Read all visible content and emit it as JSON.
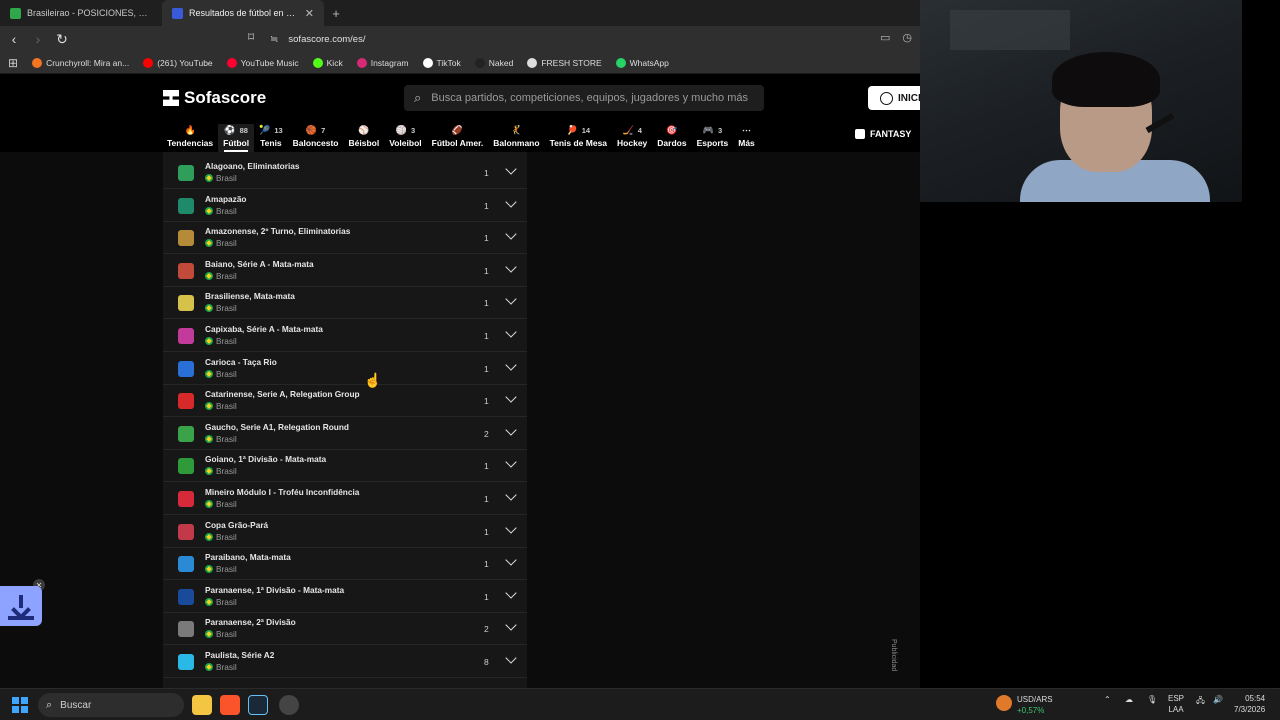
{
  "browser": {
    "tabs": [
      {
        "title": "Brasileirao - POSICIONES, RESULTADO",
        "active": false,
        "favicon_color": "#2ea84a"
      },
      {
        "title": "Resultados de fútbol en directo",
        "active": true,
        "favicon_color": "#3a5bd9"
      }
    ],
    "url": "sofascore.com/es/",
    "bookmarks": [
      {
        "label": "Crunchyroll: Mira an...",
        "color": "#f47521"
      },
      {
        "label": "(261) YouTube",
        "color": "#ff0000"
      },
      {
        "label": "YouTube Music",
        "color": "#ff0033"
      },
      {
        "label": "Kick",
        "color": "#53fc18"
      },
      {
        "label": "Instagram",
        "color": "#d62976"
      },
      {
        "label": "TikTok",
        "color": "#ffffff"
      },
      {
        "label": "Naked",
        "color": "#222222"
      },
      {
        "label": "FRESH STORE",
        "color": "#dddddd"
      },
      {
        "label": "WhatsApp",
        "color": "#25d366"
      }
    ]
  },
  "site": {
    "brand": "Sofascore",
    "search_placeholder": "Busca partidos, competiciones, equipos, jugadores y mucho más",
    "login_label": "INICI",
    "fantasy_label": "FANTASY",
    "ad_label": "Publicidad",
    "sports": [
      {
        "label": "Tendencias",
        "count": "",
        "icon": "flame-icon",
        "glyph": "🔥"
      },
      {
        "label": "Fútbol",
        "count": "88",
        "icon": "soccer-ball-icon",
        "glyph": "⚽",
        "active": true
      },
      {
        "label": "Tenis",
        "count": "13",
        "icon": "tennis-icon",
        "glyph": "🎾"
      },
      {
        "label": "Baloncesto",
        "count": "7",
        "icon": "basketball-icon",
        "glyph": "🏀"
      },
      {
        "label": "Béisbol",
        "count": "",
        "icon": "baseball-icon",
        "glyph": "⚾"
      },
      {
        "label": "Voleibol",
        "count": "3",
        "icon": "volleyball-icon",
        "glyph": "🏐"
      },
      {
        "label": "Fútbol Amer.",
        "count": "",
        "icon": "american-football-icon",
        "glyph": "🏈"
      },
      {
        "label": "Balonmano",
        "count": "",
        "icon": "handball-icon",
        "glyph": "🤾"
      },
      {
        "label": "Tenis de Mesa",
        "count": "14",
        "icon": "table-tennis-icon",
        "glyph": "🏓"
      },
      {
        "label": "Hockey",
        "count": "4",
        "icon": "hockey-icon",
        "glyph": "🏒"
      },
      {
        "label": "Dardos",
        "count": "",
        "icon": "darts-icon",
        "glyph": "🎯"
      },
      {
        "label": "Esports",
        "count": "3",
        "icon": "esports-icon",
        "glyph": "🎮"
      },
      {
        "label": "Más",
        "count": "",
        "icon": "more-icon",
        "glyph": "⋯"
      }
    ],
    "tournaments": [
      {
        "name": "Alagoano, Eliminatorias",
        "country": "Brasil",
        "count": "1",
        "color": "#2f9e5a"
      },
      {
        "name": "Amapazão",
        "country": "Brasil",
        "count": "1",
        "color": "#1e8a6a"
      },
      {
        "name": "Amazonense, 2º Turno, Eliminatorias",
        "country": "Brasil",
        "count": "1",
        "color": "#b58b3a"
      },
      {
        "name": "Baiano, Série A - Mata-mata",
        "country": "Brasil",
        "count": "1",
        "color": "#c24a3a"
      },
      {
        "name": "Brasiliense, Mata-mata",
        "country": "Brasil",
        "count": "1",
        "color": "#d6c24a"
      },
      {
        "name": "Capixaba, Série A - Mata-mata",
        "country": "Brasil",
        "count": "1",
        "color": "#c23a9a"
      },
      {
        "name": "Carioca - Taça Rio",
        "country": "Brasil",
        "count": "1",
        "color": "#2a6fd6"
      },
      {
        "name": "Catarinense, Serie A, Relegation Group",
        "country": "Brasil",
        "count": "1",
        "color": "#d62a2a"
      },
      {
        "name": "Gaucho, Serie A1, Relegation Round",
        "country": "Brasil",
        "count": "2",
        "color": "#3aa34a"
      },
      {
        "name": "Goiano, 1ª Divisão - Mata-mata",
        "country": "Brasil",
        "count": "1",
        "color": "#2e9a3a"
      },
      {
        "name": "Mineiro Módulo I - Troféu Inconfidência",
        "country": "Brasil",
        "count": "1",
        "color": "#d62a3a"
      },
      {
        "name": "Copa Grão-Pará",
        "country": "Brasil",
        "count": "1",
        "color": "#c23a4a"
      },
      {
        "name": "Paraibano, Mata-mata",
        "country": "Brasil",
        "count": "1",
        "color": "#2a8ad6"
      },
      {
        "name": "Paranaense, 1ª Divisão - Mata-mata",
        "country": "Brasil",
        "count": "1",
        "color": "#1a4a9a"
      },
      {
        "name": "Paranaense, 2ª Divisão",
        "country": "Brasil",
        "count": "2",
        "color": "#7a7a7a"
      },
      {
        "name": "Paulista, Série A2",
        "country": "Brasil",
        "count": "8",
        "color": "#2ab8e6"
      }
    ]
  },
  "taskbar": {
    "search_label": "Buscar",
    "currency_pair": "USD/ARS",
    "currency_change": "+0,57%",
    "lang_top": "ESP",
    "lang_bottom": "LAA",
    "time": "05:54",
    "date": "7/3/2026"
  }
}
